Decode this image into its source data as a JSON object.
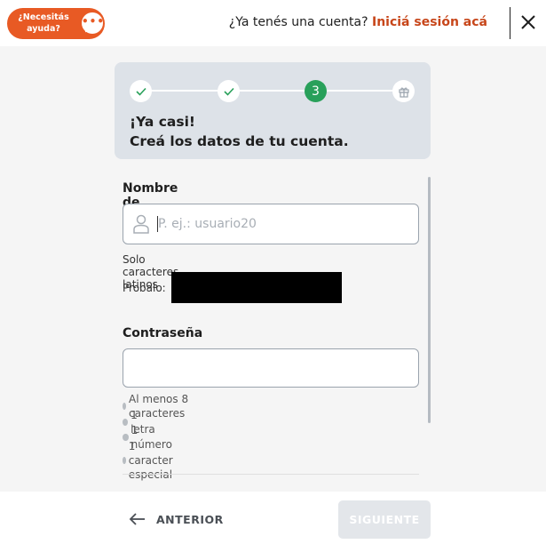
{
  "header": {
    "help_label": "¿Necesitás\nayuda?",
    "help_icon": "chat-bubble-icon",
    "login_prompt": "¿Ya tenés una cuenta?",
    "login_link": "Iniciá sesión acá",
    "close_icon": "close-icon"
  },
  "steps": {
    "items": [
      {
        "state": "done",
        "icon": "check-icon"
      },
      {
        "state": "done",
        "icon": "check-icon"
      },
      {
        "state": "active",
        "number": "3"
      },
      {
        "state": "pending",
        "icon": "gift-icon"
      }
    ],
    "title_line1": "¡Ya casi!",
    "title_line2": "Creá los datos de tu cuenta."
  },
  "form": {
    "username_label": "Nombre de usuario",
    "username_placeholder": "P. ej.: usuario20",
    "username_value": "",
    "username_hint": "Solo caracteres latinos",
    "suggestion_label": "Probalo:",
    "password_label": "Contraseña",
    "password_value": "",
    "password_requirements": [
      "Al menos 8 caracteres",
      "1 letra",
      "1 número",
      "1 caracter especial"
    ]
  },
  "footer": {
    "back_label": "ANTERIOR",
    "next_label": "SIGUIENTE"
  },
  "colors": {
    "brand_orange": "#e85a24",
    "link_orange": "#c7461a",
    "step_active_green": "#28a05a",
    "step_check_green": "#28a05a",
    "card_bg": "#dde2e8",
    "disabled_button_bg": "#e3e6ea"
  }
}
